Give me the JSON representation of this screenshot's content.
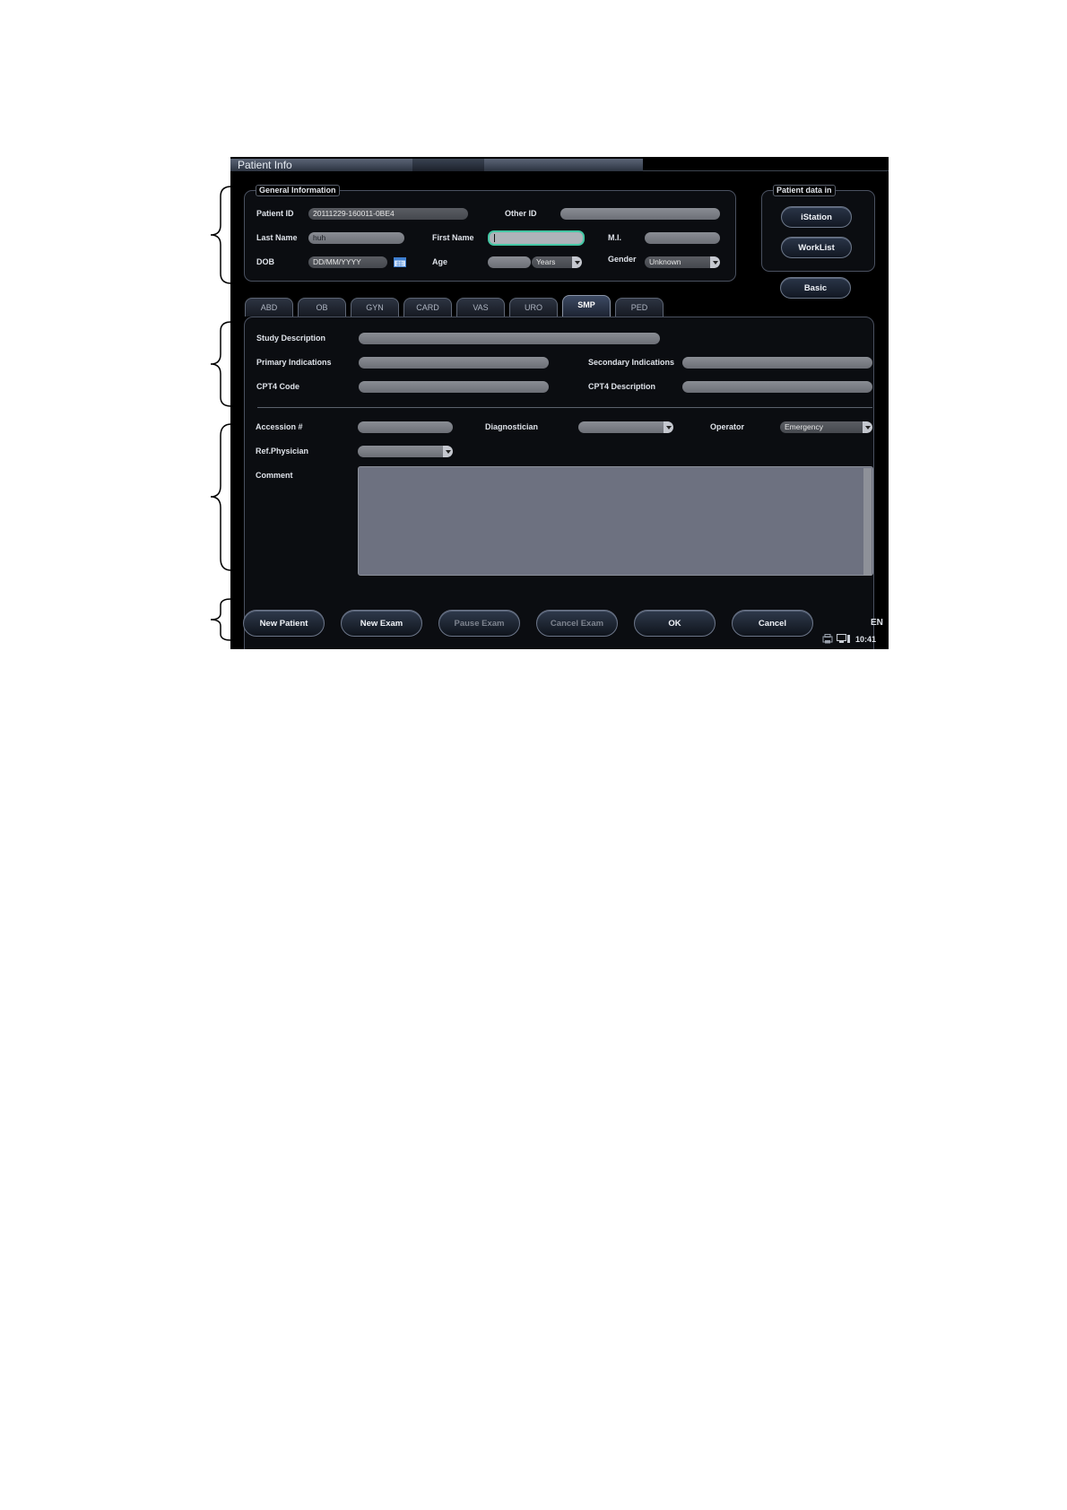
{
  "window": {
    "title": "Patient Info"
  },
  "general": {
    "legend": "General Information",
    "patient_id_label": "Patient ID",
    "patient_id_value": "20111229-160011-0BE4",
    "other_id_label": "Other ID",
    "last_name_label": "Last Name",
    "last_name_value": "huh",
    "first_name_label": "First Name",
    "mi_label": "M.I.",
    "dob_label": "DOB",
    "dob_placeholder": "DD/MM/YYYY",
    "age_label": "Age",
    "age_unit": "Years",
    "gender_label": "Gender",
    "gender_value": "Unknown"
  },
  "patient_data_in": {
    "legend": "Patient data in",
    "istation": "iStation",
    "worklist": "WorkList",
    "basic": "Basic"
  },
  "tabs": [
    "ABD",
    "OB",
    "GYN",
    "CARD",
    "VAS",
    "URO",
    "SMP",
    "PED"
  ],
  "active_tab": "SMP",
  "study": {
    "study_description_label": "Study Description",
    "primary_indications_label": "Primary Indications",
    "secondary_indications_label": "Secondary Indications",
    "cpt4_code_label": "CPT4 Code",
    "cpt4_description_label": "CPT4 Description",
    "accession_label": "Accession #",
    "diagnostician_label": "Diagnostician",
    "operator_label": "Operator",
    "operator_value": "Emergency",
    "ref_physician_label": "Ref.Physician",
    "comment_label": "Comment"
  },
  "buttons": {
    "new_patient": "New Patient",
    "new_exam": "New Exam",
    "pause_exam": "Pause Exam",
    "cancel_exam": "Cancel Exam",
    "ok": "OK",
    "cancel": "Cancel"
  },
  "status": {
    "language": "EN",
    "time": "10:41"
  },
  "colors": {
    "screen_bg": "#000000",
    "active_field_border": "#44c7a4",
    "field_bg": "#7c7f86",
    "comment_bg": "#6d7180"
  }
}
